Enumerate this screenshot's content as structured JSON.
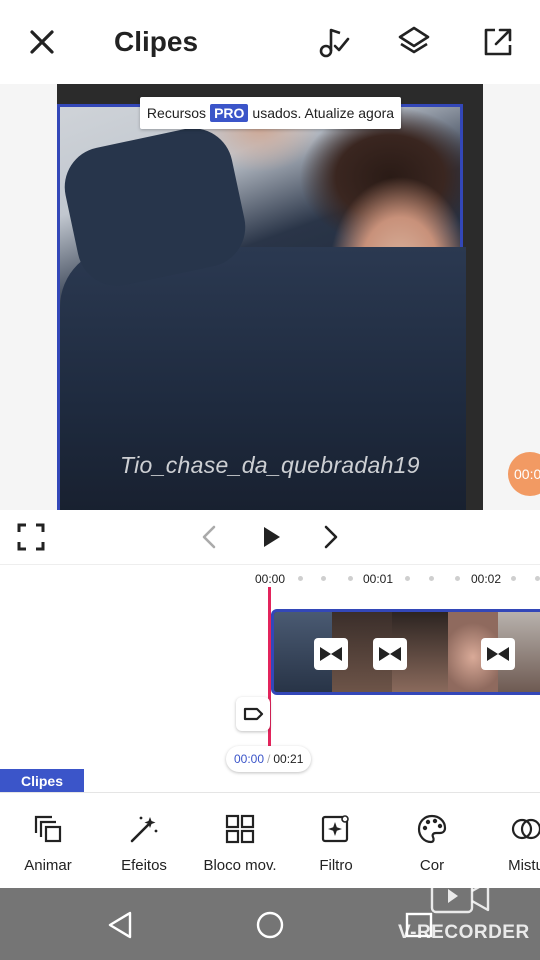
{
  "header": {
    "title": "Clipes",
    "close_icon": "close-icon",
    "icons": [
      "music-note-check-icon",
      "layers-icon",
      "export-icon"
    ]
  },
  "preview": {
    "pro_banner_prefix": "Recursos",
    "pro_badge": "PRO",
    "pro_banner_suffix": "usados. Atualize agora",
    "watermark": "Tio_chase_da_quebradah19",
    "orange_bubble": "00:0",
    "colors": {
      "frame_border": "#3347b8",
      "badge": "#3b55c9",
      "bubble": "#f29a63"
    }
  },
  "controls": {
    "fullscreen_icon": "fullscreen-icon",
    "prev_icon": "chevron-left-icon",
    "play_icon": "play-icon",
    "next_icon": "chevron-right-icon"
  },
  "timeline": {
    "ticks": [
      "00:00",
      "00:01",
      "00:02"
    ],
    "current_time": "00:00",
    "separator": "/",
    "total_time": "00:21",
    "tag_icon": "tag-icon",
    "transition_icon": "bowtie-transition-icon",
    "playhead_color": "#e3245c"
  },
  "section_tab": {
    "label": "Clipes"
  },
  "tools": [
    {
      "label": "Animar",
      "icon": "copy-stack-icon"
    },
    {
      "label": "Efeitos",
      "icon": "magic-wand-icon"
    },
    {
      "label": "Bloco mov.",
      "icon": "grid-icon"
    },
    {
      "label": "Filtro",
      "icon": "filter-sparkle-icon"
    },
    {
      "label": "Cor",
      "icon": "palette-icon"
    },
    {
      "label": "Mistu",
      "icon": "blend-circles-icon"
    }
  ],
  "system_nav": {
    "back_icon": "back-triangle-icon",
    "home_icon": "home-circle-icon",
    "recorder_label": "V-RECORDER"
  }
}
